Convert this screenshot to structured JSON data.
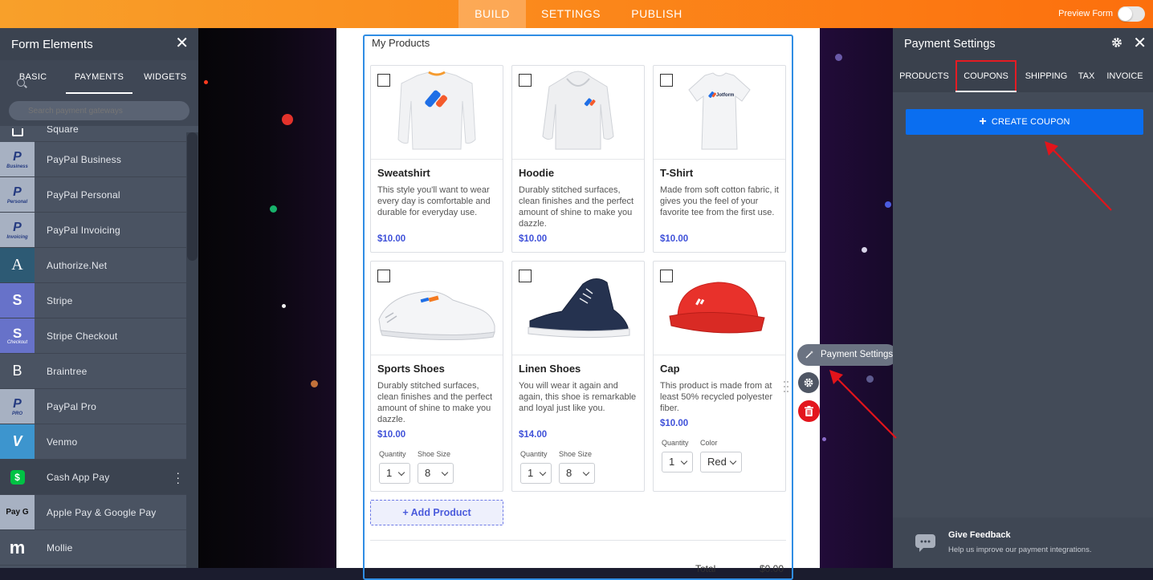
{
  "topbar": {
    "tabs": [
      "BUILD",
      "SETTINGS",
      "PUBLISH"
    ],
    "active_tab": "BUILD",
    "preview_label": "Preview Form",
    "preview_enabled": false
  },
  "left_panel": {
    "title": "Form Elements",
    "tabs": [
      "BASIC",
      "PAYMENTS",
      "WIDGETS"
    ],
    "active_tab": "PAYMENTS",
    "search_placeholder": "Search payment gateways",
    "gateways": [
      {
        "label": "Square",
        "icon": "square-icon",
        "color": "#4a5362"
      },
      {
        "label": "PayPal Business",
        "icon": "paypal-icon",
        "sub": "Business",
        "color": "#a7b1c2"
      },
      {
        "label": "PayPal Personal",
        "icon": "paypal-icon",
        "sub": "Personal",
        "color": "#a7b1c2"
      },
      {
        "label": "PayPal Invoicing",
        "icon": "paypal-icon",
        "sub": "Invoicing",
        "color": "#a7b1c2"
      },
      {
        "label": "Authorize.Net",
        "icon": "authorize-net-icon",
        "glyph": "A",
        "color": "#2d5a74"
      },
      {
        "label": "Stripe",
        "icon": "stripe-icon",
        "glyph": "S",
        "color": "#6772c9"
      },
      {
        "label": "Stripe Checkout",
        "icon": "stripe-checkout-icon",
        "glyph": "S",
        "sub": "Checkout",
        "color": "#6772c9"
      },
      {
        "label": "Braintree",
        "icon": "braintree-icon",
        "glyph": "B",
        "color": "#4a5362"
      },
      {
        "label": "PayPal Pro",
        "icon": "paypal-icon",
        "sub": "PRO",
        "color": "#a7b1c2"
      },
      {
        "label": "Venmo",
        "icon": "venmo-icon",
        "glyph": "V",
        "color": "#3d95ce"
      },
      {
        "label": "Cash App Pay",
        "icon": "cash-app-icon",
        "glyph": "$",
        "color": "#3b4350",
        "selected": true
      },
      {
        "label": "Apple Pay & Google Pay",
        "icon": "apple-google-pay-icon",
        "glyph": "Pay G",
        "color": "#a7b1c2"
      },
      {
        "label": "Mollie",
        "icon": "mollie-icon",
        "glyph": "m",
        "color": "#4a5362"
      }
    ]
  },
  "form": {
    "widget_title": "My Products",
    "products": [
      {
        "name": "Sweatshirt",
        "description": "This style you'll want to wear every day is comfortable and durable for everyday use.",
        "price": "$10.00",
        "image": "sweatshirt-image"
      },
      {
        "name": "Hoodie",
        "description": "Durably stitched surfaces, clean finishes and the perfect amount of shine to make you dazzle.",
        "price": "$10.00",
        "image": "hoodie-image"
      },
      {
        "name": "T-Shirt",
        "description": "Made from soft cotton fabric, it gives you the feel of your favorite tee from the first use.",
        "price": "$10.00",
        "image": "tshirt-image"
      },
      {
        "name": "Sports Shoes",
        "description": "Durably stitched surfaces, clean finishes and the perfect amount of shine to make you dazzle.",
        "price": "$10.00",
        "image": "sports-shoes-image",
        "options": [
          {
            "label": "Quantity",
            "value": "1"
          },
          {
            "label": "Shoe Size",
            "value": "8"
          }
        ]
      },
      {
        "name": "Linen Shoes",
        "description": "You will wear it again and again, this shoe is remarkable and loyal just like you.",
        "price": "$14.00",
        "image": "linen-shoes-image",
        "options": [
          {
            "label": "Quantity",
            "value": "1"
          },
          {
            "label": "Shoe Size",
            "value": "8"
          }
        ]
      },
      {
        "name": "Cap",
        "description": "This product is made from at least 50% recycled polyester fiber.",
        "price": "$10.00",
        "image": "cap-image",
        "options": [
          {
            "label": "Quantity",
            "value": "1"
          },
          {
            "label": "Color",
            "value": "Red"
          }
        ]
      }
    ],
    "add_product_label": "+ Add Product",
    "total_label": "Total",
    "total_value": "$0.00"
  },
  "tools": {
    "payment_settings_label": "Payment Settings"
  },
  "right_panel": {
    "title": "Payment Settings",
    "tabs": [
      "PRODUCTS",
      "COUPONS",
      "SHIPPING",
      "TAX",
      "INVOICE"
    ],
    "active_tab": "COUPONS",
    "create_coupon_label": "CREATE COUPON",
    "feedback_title": "Give Feedback",
    "feedback_subtitle": "Help us improve our payment integrations."
  },
  "colors": {
    "accent_blue": "#0a6ef0",
    "price_blue": "#3f51d9",
    "highlight_red": "#e51b23",
    "topbar_orange": "#fb8a1c"
  }
}
